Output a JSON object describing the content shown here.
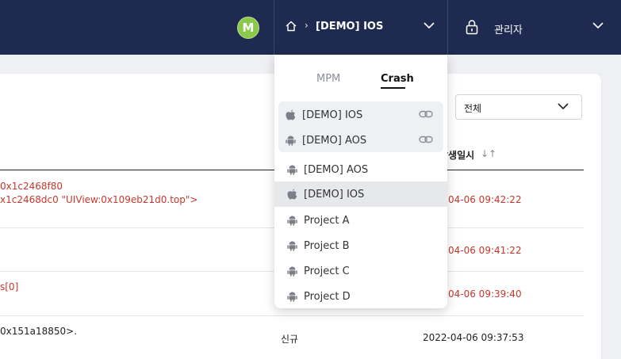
{
  "header": {
    "avatar_initial": "M",
    "project_name": "[DEMO] IOS",
    "breadcrumb_arrow": "›",
    "user_name": "관리자"
  },
  "dropdown": {
    "tabs": [
      {
        "label": "MPM",
        "active": false
      },
      {
        "label": "Crash",
        "active": true
      }
    ],
    "favorites": [
      {
        "label": "[DEMO] IOS",
        "platform": "apple-icon"
      },
      {
        "label": "[DEMO] AOS",
        "platform": "android-icon"
      }
    ],
    "projects": [
      {
        "label": "[DEMO] AOS",
        "platform": "android-icon"
      },
      {
        "label": "[DEMO] IOS",
        "platform": "apple-icon",
        "highlighted": true
      },
      {
        "label": "Project A",
        "platform": "android-icon"
      },
      {
        "label": "Project B",
        "platform": "android-icon"
      },
      {
        "label": "Project C",
        "platform": "android-icon"
      },
      {
        "label": "Project D",
        "platform": "android-icon"
      }
    ]
  },
  "filter": {
    "value": "전체"
  },
  "table": {
    "date_header": "발생일시",
    "sort_glyph": "↓↑",
    "rows": [
      {
        "msg_line1": "0x1c2468f80",
        "msg_line2": "x1c2468dc0 \"UIView:0x109eb21d0.top\">",
        "status": "",
        "date": "04-06 09:42:22",
        "red": true
      },
      {
        "msg_line1": "",
        "msg_line2": "",
        "status": "",
        "date": "04-06 09:41:22",
        "red": true
      },
      {
        "msg_line1": "s[0]",
        "msg_line2": "",
        "status": "",
        "date": "04-06 09:39:40",
        "red": true
      },
      {
        "msg_line1": "0x151a18850>.",
        "msg_line2": "",
        "status": "신규",
        "date": "2022-04-06 09:37:53",
        "red": false
      }
    ]
  },
  "colors": {
    "topbar": "#1e2a4f",
    "avatar": "#8cc84b",
    "error_text": "#c8372d"
  }
}
